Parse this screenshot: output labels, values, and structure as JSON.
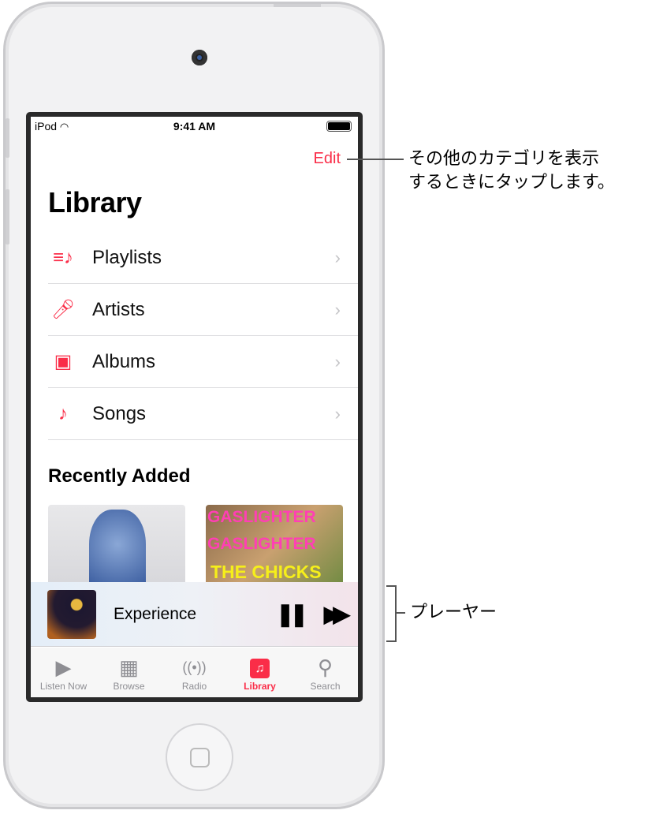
{
  "status_bar": {
    "carrier": "iPod",
    "time": "9:41 AM"
  },
  "header": {
    "edit": "Edit",
    "title": "Library"
  },
  "library_items": [
    {
      "label": "Playlists",
      "icon": "playlist-icon"
    },
    {
      "label": "Artists",
      "icon": "microphone-icon"
    },
    {
      "label": "Albums",
      "icon": "album-icon"
    },
    {
      "label": "Songs",
      "icon": "music-note-icon"
    }
  ],
  "recently_added": {
    "title": "Recently Added",
    "albums": [
      {
        "art_text": ""
      },
      {
        "art_text_1": "GASLIGHTER",
        "art_text_2": "GASLIGHTER",
        "art_text_3": "THE CHICKS"
      }
    ]
  },
  "player": {
    "song": "Experience"
  },
  "tabs": [
    {
      "label": "Listen Now"
    },
    {
      "label": "Browse"
    },
    {
      "label": "Radio"
    },
    {
      "label": "Library",
      "active": true
    },
    {
      "label": "Search"
    }
  ],
  "callouts": {
    "edit": "その他のカテゴリを表示\nするときにタップします。",
    "player": "プレーヤー"
  },
  "colors": {
    "accent": "#fa2d48"
  }
}
